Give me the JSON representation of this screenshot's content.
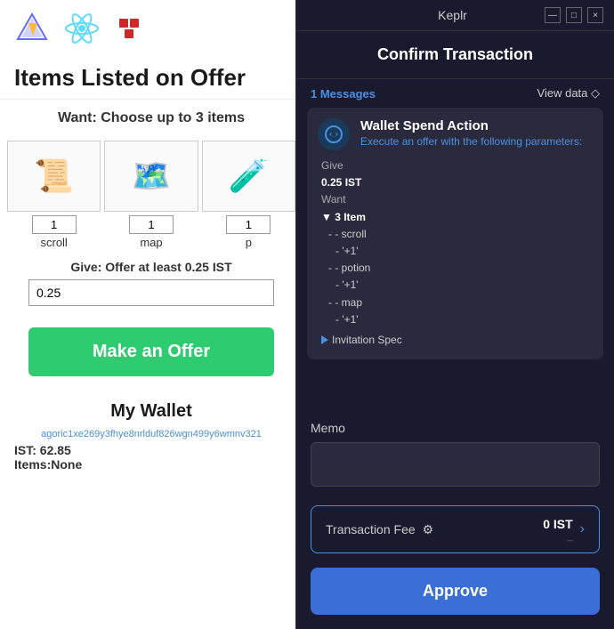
{
  "webapp": {
    "title": "Items Listed on Offer",
    "toolbar": {
      "logos": [
        "vite",
        "react",
        "redux"
      ]
    },
    "want_section": {
      "label": "Want: Choose up to 3 items",
      "items": [
        {
          "id": "scroll",
          "emoji": "📜",
          "qty": "1",
          "name": "scroll"
        },
        {
          "id": "map",
          "emoji": "🗺️",
          "qty": "1",
          "name": "map"
        },
        {
          "id": "potion",
          "emoji": "🧪",
          "qty": "1",
          "name": "p"
        }
      ]
    },
    "give_section": {
      "label": "Give: Offer at least 0.25 IST",
      "value": "0.25"
    },
    "make_offer_button": "Make an Offer",
    "wallet_section": {
      "title": "My Wallet",
      "address": "agoric1xe269y3fhye8nrlduf826wgn499y6wmnv321",
      "ist": "IST: 62.85",
      "items": "Items:None"
    }
  },
  "keplr": {
    "window_title": "Keplr",
    "min_btn": "—",
    "max_btn": "□",
    "close_btn": "×",
    "header": "Confirm Transaction",
    "messages_bar": {
      "count_label": "1 Messages",
      "view_data_label": "View data ◇"
    },
    "message_card": {
      "title": "Wallet Spend Action",
      "subtitle": "Execute an offer with the following parameters:",
      "give_label": "Give",
      "give_value": "0.25 IST",
      "want_label": "Want",
      "want_items_label": "▼ 3 Item",
      "items": [
        {
          "name": "- - scroll",
          "qty": "- '+1'"
        },
        {
          "name": "- - potion",
          "qty": "- '+1'"
        },
        {
          "name": "- - map",
          "qty": "- '+1'"
        }
      ],
      "invitation_label": "Invitation Spec"
    },
    "memo_section": {
      "label": "Memo",
      "placeholder": ""
    },
    "fee_section": {
      "label": "Transaction Fee",
      "amount": "0 IST",
      "sub": "_"
    },
    "approve_button": "Approve"
  }
}
